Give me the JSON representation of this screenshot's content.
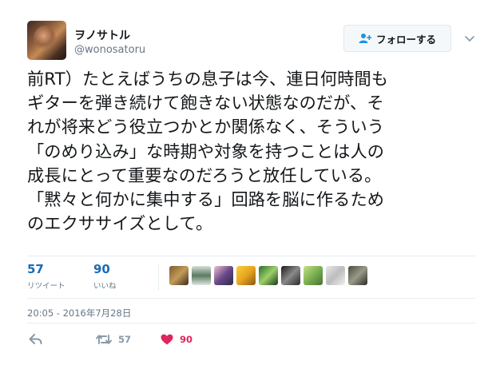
{
  "user": {
    "display_name": "ヲノサトル",
    "handle": "@wonosatoru"
  },
  "follow_button": {
    "label": "フォローする",
    "icon": "person-add-icon"
  },
  "more_icon": "chevron-down-icon",
  "tweet": {
    "lines": [
      "前RT）たとえばうちの息子は今、連日何時間も",
      "ギターを弾き続けて飽きない状態なのだが、そ",
      "れが将来どう役立つかとか関係なく、そういう",
      "「のめり込み」な時期や対象を持つことは人の",
      "成長にとって重要なのだろうと放任している。",
      "「黙々と何かに集中する」回路を脳に作るため",
      "のエクササイズとして。"
    ]
  },
  "stats": {
    "retweets": {
      "count": "57",
      "label": "リツイート"
    },
    "likes": {
      "count": "90",
      "label": "いいね"
    }
  },
  "timestamp": "20:05 - 2016年7月28日",
  "actions": {
    "reply_icon": "reply-icon",
    "retweet_icon": "retweet-icon",
    "retweet_count": "57",
    "like_icon": "heart-icon",
    "like_count": "90"
  },
  "colors": {
    "link_blue": "#1b6bb5",
    "muted": "#657786",
    "like_red": "#e0245e",
    "divider": "#e6ecf0"
  }
}
